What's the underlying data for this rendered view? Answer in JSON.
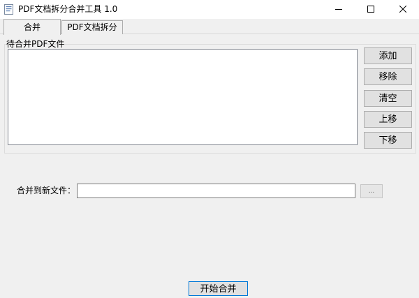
{
  "window": {
    "title": "PDF文档拆分合并工具 1.0"
  },
  "tabs": [
    {
      "label": "合并",
      "selected": true
    },
    {
      "label": "PDF文档拆分",
      "selected": false
    }
  ],
  "merge": {
    "group_label": "待合并PDF文件",
    "buttons": {
      "add": "添加",
      "remove": "移除",
      "clear": "清空",
      "move_up": "上移",
      "move_down": "下移"
    },
    "output_label": "合并到新文件：",
    "output_value": "",
    "browse": "...",
    "start": "开始合并"
  },
  "colors": {
    "focus_border": "#0078d7",
    "button_face": "#e1e1e1",
    "window_bg": "#f0f0f0"
  }
}
